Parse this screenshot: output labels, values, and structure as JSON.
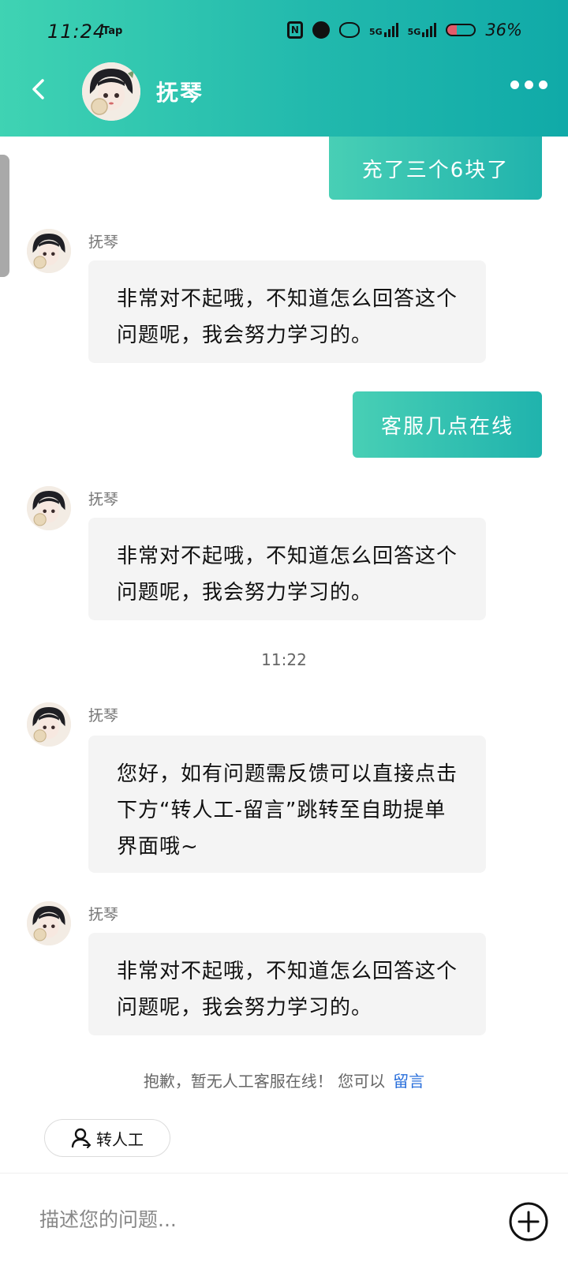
{
  "status_bar": {
    "time": "11:24",
    "tap_label": "Tap",
    "sim1_label": "5G",
    "sim2_label": "5G",
    "battery_percent": "36%",
    "battery_level": 0.36
  },
  "header": {
    "title": "抚琴"
  },
  "messages": [
    {
      "direction": "out",
      "text": "充了三个6块了"
    },
    {
      "direction": "in",
      "sender": "抚琴",
      "text": "非常对不起哦，不知道怎么回答这个问题呢，我会努力学习的。"
    },
    {
      "direction": "out",
      "text": "客服几点在线"
    },
    {
      "direction": "in",
      "sender": "抚琴",
      "text": "非常对不起哦，不知道怎么回答这个问题呢，我会努力学习的。"
    },
    {
      "direction": "in",
      "sender": "抚琴",
      "text": "您好，如有问题需反馈可以直接点击下方“转人工-留言”跳转至自助提单界面哦~"
    },
    {
      "direction": "in",
      "sender": "抚琴",
      "text": "非常对不起哦，不知道怎么回答这个问题呢，我会努力学习的。"
    }
  ],
  "timestamp": "11:22",
  "notice": {
    "text": "抱歉，暂无人工客服在线！ 您可以",
    "link": "留言"
  },
  "transfer_button": {
    "label": "转人工"
  },
  "input": {
    "placeholder": "描述您的问题..."
  },
  "colors": {
    "header_start": "#3fd3b3",
    "header_end": "#10aaa8",
    "link": "#2a6fdb",
    "incoming_bubble": "#f4f4f4"
  }
}
